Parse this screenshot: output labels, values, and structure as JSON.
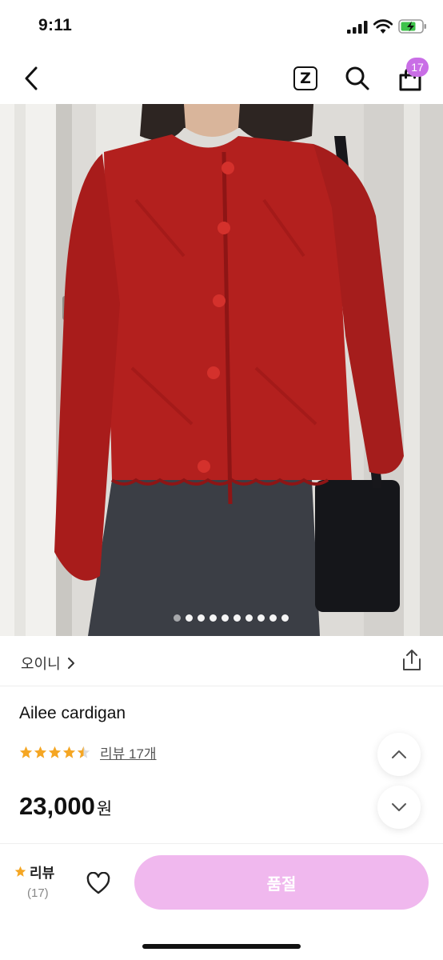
{
  "status_bar": {
    "time": "9:11"
  },
  "header": {
    "back_icon": "chevron-left-icon",
    "z_label": "Z",
    "cart_badge": "17"
  },
  "gallery": {
    "total_dots": 10,
    "active_index": 0
  },
  "shop": {
    "name": "오이니"
  },
  "product": {
    "title": "Ailee cardigan",
    "rating": 4.5,
    "review_link": "리뷰 17개",
    "price": "23,000",
    "currency": "원"
  },
  "bottom_bar": {
    "review_label": "리뷰",
    "review_count": "(17)",
    "soldout_label": "품절"
  },
  "colors": {
    "accent": "#c96ee6",
    "soldout_button": "#f0b8ee",
    "star": "#f5a623",
    "cardigan": "#b3201e"
  }
}
